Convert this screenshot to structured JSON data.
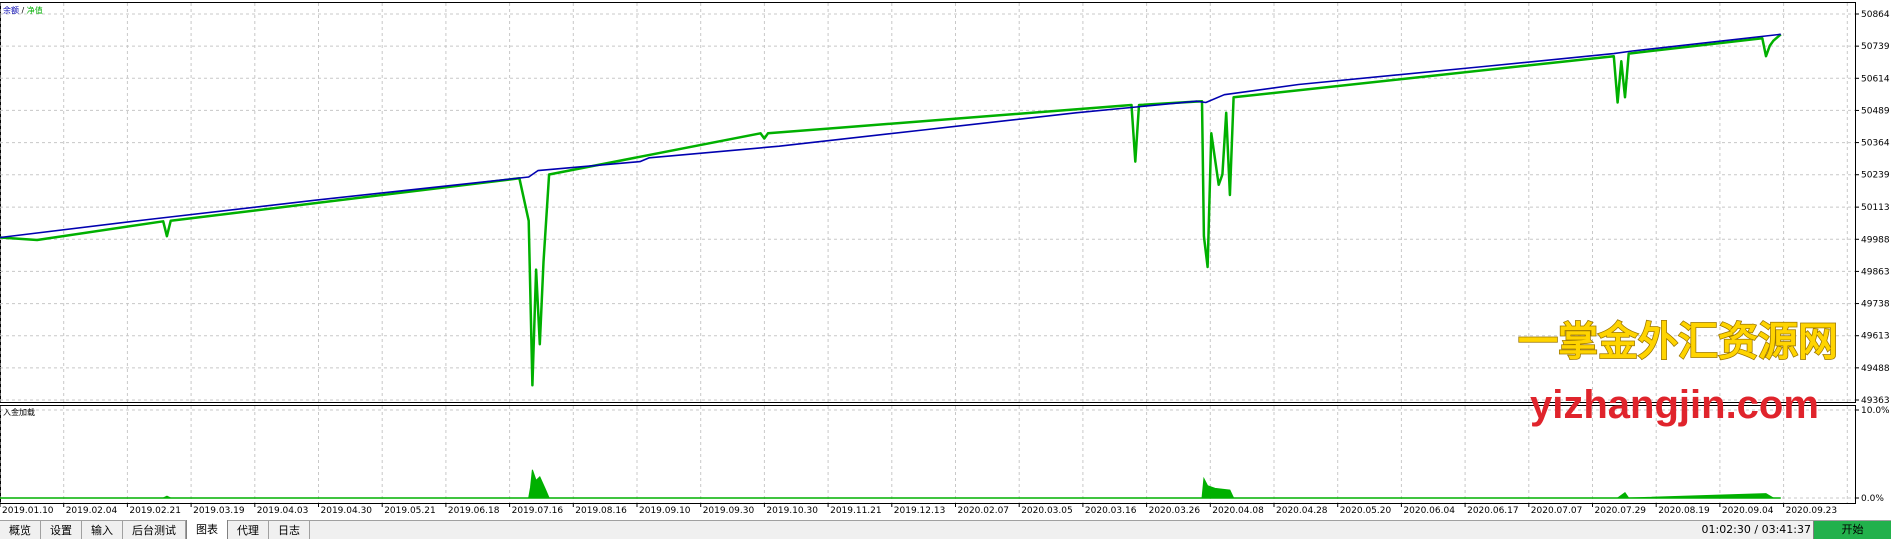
{
  "legend": {
    "balance": "余额",
    "sep": " / ",
    "equity": "净值"
  },
  "lower_panel_label": "入金加载",
  "watermark": {
    "line1": "一掌金外汇资源网",
    "line2": "yizhangjin.com"
  },
  "tabs": [
    {
      "label": "概览"
    },
    {
      "label": "设置"
    },
    {
      "label": "输入"
    },
    {
      "label": "后台测试"
    },
    {
      "label": "图表",
      "active": true
    },
    {
      "label": "代理"
    },
    {
      "label": "日志"
    }
  ],
  "status_time": "01:02:30 / 03:41:37",
  "start_button": "开始",
  "colors": {
    "balance": "#0000b0",
    "equity": "#00b000",
    "grid": "#c0c0c0",
    "watermark": "#ffd400",
    "watermark_stroke": "#9a7400",
    "watermark2": "#e0242c"
  },
  "chart_data": [
    {
      "type": "line",
      "title": "",
      "series": [
        {
          "name": "余额",
          "color": "#0000b0",
          "x": [
            0,
            0.08,
            0.17,
            0.285,
            0.29,
            0.345,
            0.35,
            0.42,
            0.5,
            0.58,
            0.645,
            0.65,
            0.66,
            0.7,
            0.8,
            0.87,
            0.88,
            0.96
          ],
          "values": [
            49995,
            50065,
            50140,
            50230,
            50255,
            50290,
            50305,
            50350,
            50415,
            50480,
            50525,
            50520,
            50550,
            50590,
            50660,
            50710,
            50720,
            50785
          ]
        },
        {
          "name": "净值",
          "color": "#00b000",
          "x": [
            0.0,
            0.02,
            0.088,
            0.09,
            0.092,
            0.28,
            0.285,
            0.287,
            0.289,
            0.291,
            0.293,
            0.296,
            0.41,
            0.412,
            0.414,
            0.61,
            0.612,
            0.614,
            0.648,
            0.649,
            0.651,
            0.653,
            0.655,
            0.657,
            0.659,
            0.661,
            0.663,
            0.665,
            0.87,
            0.872,
            0.874,
            0.876,
            0.878,
            0.95,
            0.952,
            0.954,
            0.956,
            0.96
          ],
          "values": [
            49995,
            49985,
            50058,
            50000,
            50060,
            50225,
            50060,
            49420,
            49870,
            49580,
            49900,
            50240,
            50400,
            50380,
            50400,
            50510,
            50290,
            50510,
            50525,
            50000,
            49880,
            50400,
            50300,
            50200,
            50240,
            50480,
            50160,
            50540,
            50700,
            50520,
            50680,
            50540,
            50710,
            50770,
            50700,
            50740,
            50760,
            50785
          ]
        }
      ],
      "ylim": [
        49363,
        50900
      ],
      "y_ticks": [
        50864,
        50739,
        50614,
        50489,
        50364,
        50239,
        50113,
        49988,
        49863,
        49738,
        49613,
        49488,
        49363
      ],
      "x_ticks": [
        "2019.01.10",
        "2019.02.04",
        "2019.02.21",
        "2019.03.19",
        "2019.04.03",
        "2019.04.30",
        "2019.05.21",
        "2019.06.18",
        "2019.07.16",
        "2019.08.16",
        "2019.09.10",
        "2019.09.30",
        "2019.10.30",
        "2019.11.21",
        "2019.12.13",
        "2020.02.07",
        "2020.03.05",
        "2020.03.16",
        "2020.03.26",
        "2020.04.08",
        "2020.04.28",
        "2020.05.20",
        "2020.06.04",
        "2020.06.17",
        "2020.07.07",
        "2020.07.29",
        "2020.08.19",
        "2020.09.04",
        "2020.09.23"
      ],
      "grid": true
    },
    {
      "type": "area",
      "title": "入金加载",
      "series": [
        {
          "name": "入金加载",
          "color": "#00b000",
          "x": [
            0.088,
            0.09,
            0.092,
            0.285,
            0.286,
            0.287,
            0.289,
            0.291,
            0.294,
            0.296,
            0.648,
            0.649,
            0.651,
            0.655,
            0.659,
            0.663,
            0.665,
            0.872,
            0.876,
            0.878,
            0.952,
            0.956
          ],
          "values": [
            0,
            0.2,
            0,
            0,
            1.2,
            3.2,
            2.0,
            2.4,
            1.0,
            0,
            0,
            2.2,
            1.4,
            1.1,
            1.0,
            0.9,
            0,
            0,
            0.6,
            0,
            0.5,
            0
          ]
        }
      ],
      "ylim": [
        0,
        10
      ],
      "y_ticks": [
        "10.0%",
        "0.0%"
      ],
      "grid": true
    }
  ]
}
